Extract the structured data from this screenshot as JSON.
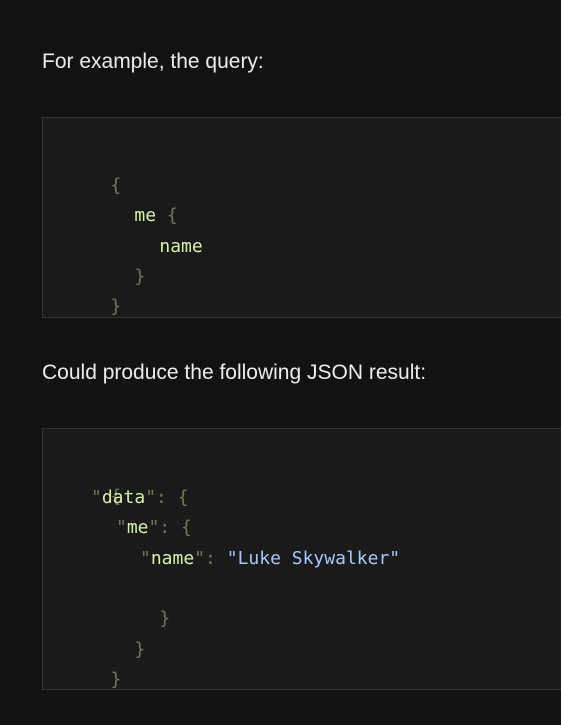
{
  "intro_text": "For example, the query:",
  "query_code": {
    "open_brace": "{",
    "me_field": "me",
    "me_open": "{",
    "name_field": "name",
    "me_close": "}",
    "close_brace": "}"
  },
  "result_text": "Could produce the following JSON result:",
  "result_code": {
    "open_brace": "{",
    "data_key_quote_open": "\"",
    "data_key": "data",
    "data_key_quote_close": "\"",
    "data_colon_brace": ": {",
    "me_key_quote_open": "\"",
    "me_key": "me",
    "me_key_quote_close": "\"",
    "me_colon_brace": ": {",
    "name_key_quote_open": "\"",
    "name_key": "name",
    "name_key_quote_close": "\"",
    "name_colon": ": ",
    "name_value": "\"Luke Skywalker\"",
    "me_close": "}",
    "data_close": "}",
    "close_brace": "}"
  },
  "colors": {
    "background": "#121212",
    "code_background": "#1a1a1a",
    "code_border": "#333333",
    "punctuation": "#6e7b56",
    "field": "#d6f2a3",
    "string": "#a3c8ff"
  }
}
